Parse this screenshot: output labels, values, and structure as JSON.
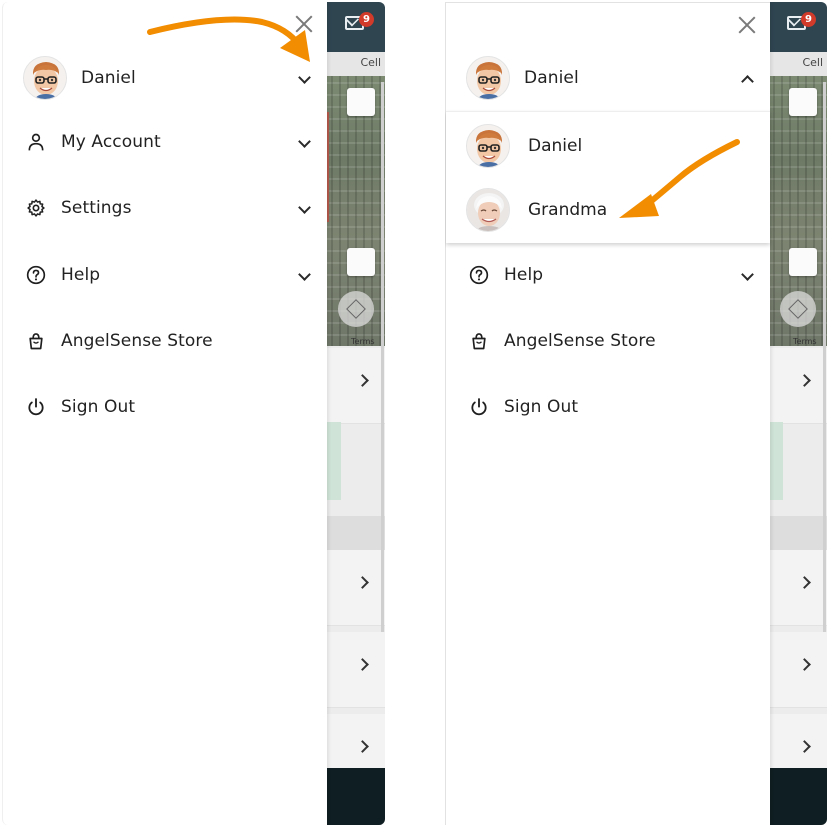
{
  "background_app": {
    "unread_count": "9",
    "tab_label": "Cell",
    "map_terms": "Terms"
  },
  "left_panel": {
    "user": {
      "name": "Daniel",
      "expanded": false
    },
    "menu": [
      {
        "label": "My Account",
        "icon": "person-icon",
        "has_chevron": true
      },
      {
        "label": "Settings",
        "icon": "gear-icon",
        "has_chevron": true
      },
      {
        "label": "Help",
        "icon": "question-circle-icon",
        "has_chevron": true
      },
      {
        "label": "AngelSense Store",
        "icon": "shopping-bag-icon",
        "has_chevron": false
      },
      {
        "label": "Sign Out",
        "icon": "power-icon",
        "has_chevron": false
      }
    ]
  },
  "right_panel": {
    "user": {
      "name": "Daniel",
      "expanded": true
    },
    "dropdown": [
      {
        "name": "Daniel"
      },
      {
        "name": "Grandma"
      }
    ],
    "menu": [
      {
        "label": "Help",
        "icon": "question-circle-icon",
        "has_chevron": true
      },
      {
        "label": "AngelSense Store",
        "icon": "shopping-bag-icon",
        "has_chevron": false
      },
      {
        "label": "Sign Out",
        "icon": "power-icon",
        "has_chevron": false
      }
    ]
  },
  "colors": {
    "arrow": "#f28c00",
    "topbar": "#2f4550",
    "badge": "#d23a2a"
  }
}
